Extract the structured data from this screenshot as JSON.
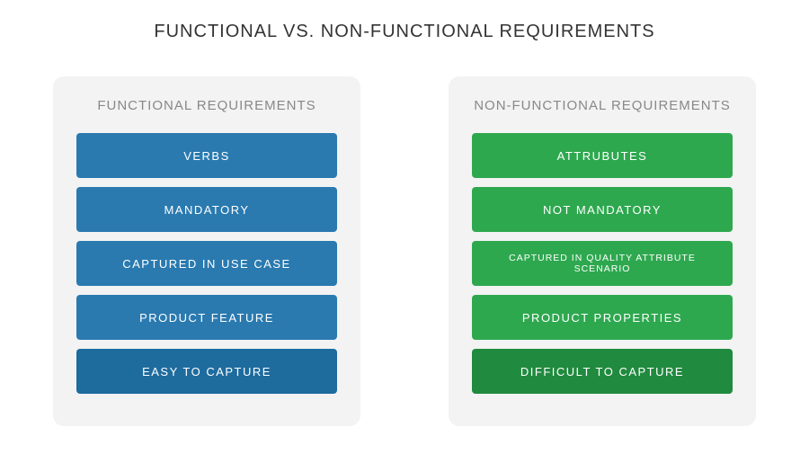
{
  "title": "FUNCTIONAL VS. NON-FUNCTIONAL REQUIREMENTS",
  "left": {
    "title": "FUNCTIONAL REQUIREMENTS",
    "items": [
      "VERBS",
      "MANDATORY",
      "CAPTURED IN USE CASE",
      "PRODUCT FEATURE",
      "EASY TO CAPTURE"
    ]
  },
  "right": {
    "title": "NON-FUNCTIONAL REQUIREMENTS",
    "items": [
      "ATTRUBUTES",
      "NOT MANDATORY",
      "CAPTURED IN QUALITY ATTRIBUTE SCENARIO",
      "PRODUCT PROPERTIES",
      "DIFFICULT TO CAPTURE"
    ]
  },
  "colors": {
    "blue": "#2a7ab0",
    "blue_dark": "#1e6b9e",
    "green": "#2ea84f",
    "green_dark": "#208a3e",
    "card_bg": "#f3f3f3"
  }
}
